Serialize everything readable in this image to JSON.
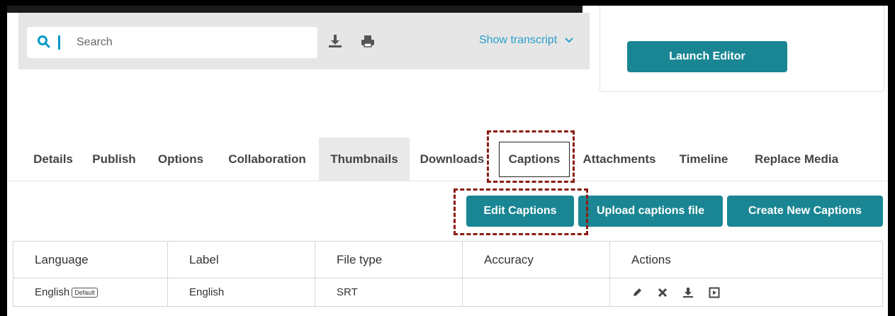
{
  "toolbar": {
    "search_placeholder": "Search",
    "show_transcript": "Show transcript"
  },
  "side_panel": {
    "launch_editor": "Launch Editor"
  },
  "tabs": [
    {
      "label": "Details"
    },
    {
      "label": "Publish"
    },
    {
      "label": "Options"
    },
    {
      "label": "Collaboration"
    },
    {
      "label": "Thumbnails"
    },
    {
      "label": "Downloads"
    },
    {
      "label": "Captions"
    },
    {
      "label": "Attachments"
    },
    {
      "label": "Timeline"
    },
    {
      "label": "Replace Media"
    }
  ],
  "actions": {
    "edit_captions": "Edit Captions",
    "upload_captions": "Upload captions file",
    "create_captions": "Create New Captions"
  },
  "table": {
    "headers": [
      "Language",
      "Label",
      "File type",
      "Accuracy",
      "Actions"
    ],
    "rows": [
      {
        "language": "English",
        "badge": "Default",
        "label": "English",
        "file_type": "SRT",
        "accuracy": ""
      }
    ]
  },
  "colors": {
    "accent": "#1a8694",
    "link": "#2a9fcf",
    "highlight_dash": "#8b1d12"
  }
}
